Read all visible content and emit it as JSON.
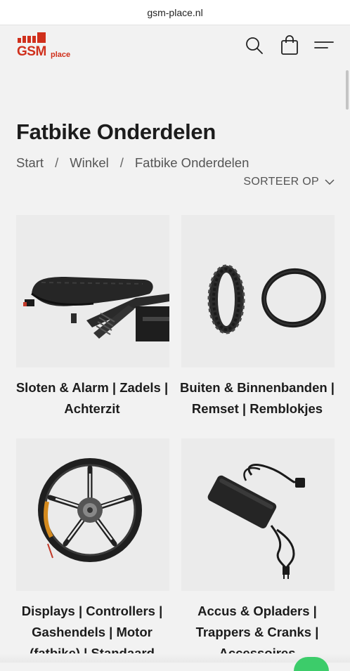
{
  "browser": {
    "url": "gsm-place.nl"
  },
  "header": {
    "logo_main": "GSM",
    "logo_sub": "place",
    "icons": [
      "search-icon",
      "shopping-bag-icon",
      "menu-icon"
    ]
  },
  "page": {
    "title": "Fatbike Onderdelen",
    "breadcrumb": [
      "Start",
      "Winkel",
      "Fatbike Onderdelen"
    ],
    "breadcrumb_separator": "/",
    "sort_label": "SORTEER OP"
  },
  "categories": [
    {
      "title_lines": [
        "Sloten & Alarm | Zadels |",
        "Achterzit"
      ],
      "image": "fatbike-seat"
    },
    {
      "title_lines": [
        "Buiten & Binnenbanden |",
        "Remset | Remblokjes"
      ],
      "image": "tire-and-inner-tube"
    },
    {
      "title_lines": [
        "Displays | Controllers |",
        "Gashendels | Motor",
        "(fatbike) | Standaard"
      ],
      "image": "wheel-hub-motor"
    },
    {
      "title_lines": [
        "Accus & Opladers |",
        "Trappers & Cranks |",
        "Accessoires"
      ],
      "image": "battery-charger"
    }
  ],
  "colors": {
    "brand": "#d0301c",
    "background": "#f2f2f2",
    "text": "#1c1c1c",
    "whatsapp": "#3ccc6a"
  }
}
